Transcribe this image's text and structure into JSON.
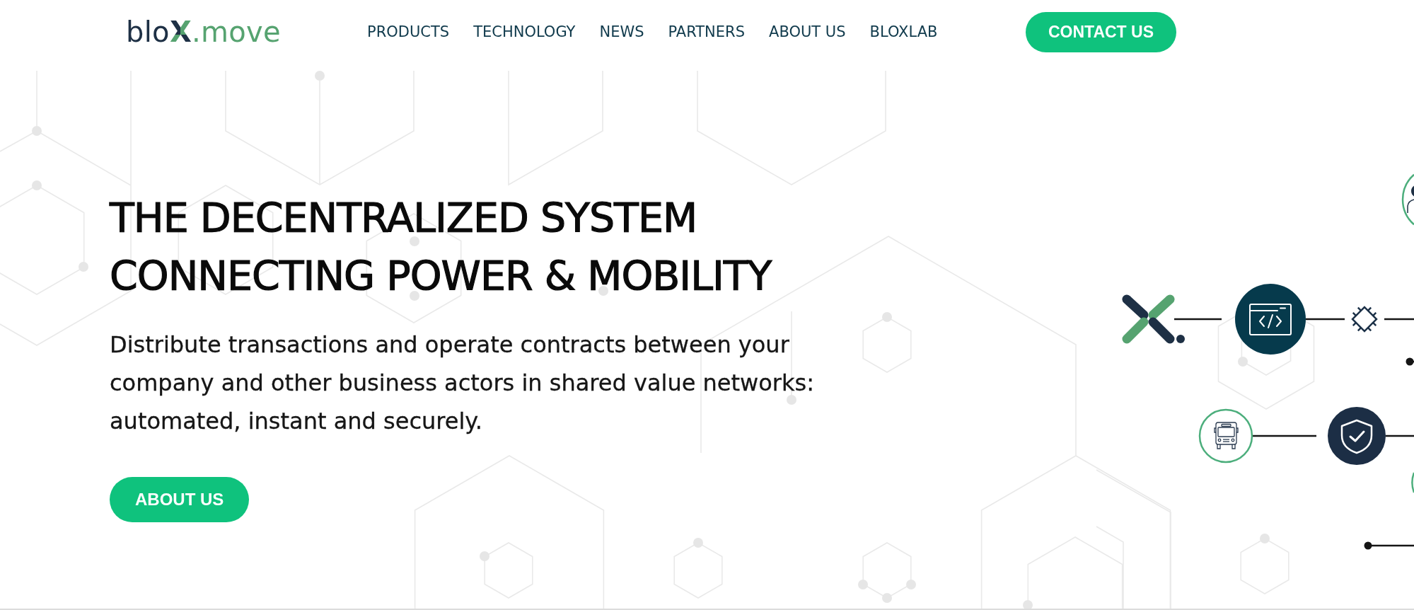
{
  "header": {
    "logo": {
      "name": "blo",
      "mark": "X",
      "suffix": ".move"
    },
    "nav": [
      {
        "label": "PRODUCTS"
      },
      {
        "label": "TECHNOLOGY"
      },
      {
        "label": "NEWS"
      },
      {
        "label": "PARTNERS"
      },
      {
        "label": "ABOUT US"
      },
      {
        "label": "BLOXLAB"
      }
    ],
    "cta": {
      "label": "CONTACT US"
    }
  },
  "hero": {
    "title": "THE DECENTRALIZED SYSTEM CONNECTING POWER & MOBILITY",
    "description": "Distribute transactions and operate contracts between your company and other business actors in shared value networks: automated, instant and securely.",
    "button": {
      "label": "ABOUT US"
    }
  }
}
